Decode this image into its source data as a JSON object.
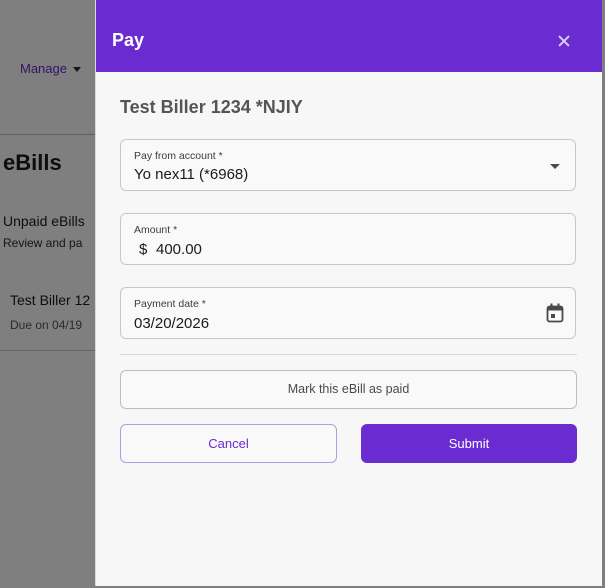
{
  "background": {
    "nav": {
      "manage_label": "Manage"
    },
    "page_title": "eBills",
    "section": {
      "title": "Unpaid eBills",
      "subtitle": "Review and pa"
    },
    "bill_row": {
      "biller": "Test Biller 12",
      "due": "Due on 04/19"
    }
  },
  "dialog": {
    "title": "Pay",
    "close_icon": "close-icon",
    "biller_name": "Test Biller 1234 *NJIY",
    "pay_from": {
      "label": "Pay from account *",
      "value": "Yo nex11 (*6968)"
    },
    "amount": {
      "label": "Amount *",
      "currency": "$",
      "value": "400.00"
    },
    "payment_date": {
      "label": "Payment date *",
      "value": "03/20/2026",
      "icon": "calendar-icon"
    },
    "mark_paid_label": "Mark this eBill as paid",
    "cancel_label": "Cancel",
    "submit_label": "Submit"
  },
  "colors": {
    "accent": "#6a2bd1",
    "overlay": "rgba(0,0,0,0.5)",
    "dialog_bg": "#f7f7f8"
  }
}
